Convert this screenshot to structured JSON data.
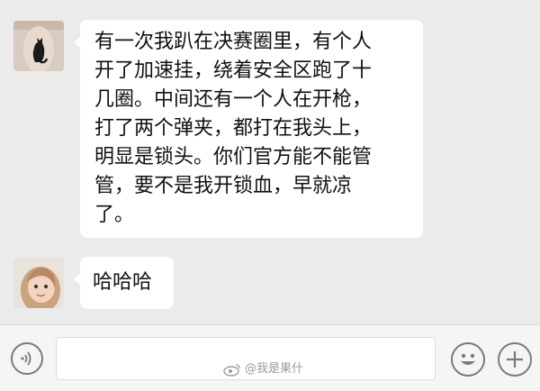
{
  "messages": [
    {
      "sender": "cat-avatar",
      "lines": [
        "有一次我趴在决赛圈里，有个人",
        "开了加速挂，绕着安全区跑了十",
        "几圈。中间还有一个人在开枪，",
        "打了两个弹夹，都打在我头上，",
        "明显是锁头。你们官方能不能管",
        "管，要不是我开锁血，早就凉",
        "了。"
      ]
    },
    {
      "sender": "girl-avatar",
      "text": "哈哈哈"
    }
  ],
  "input_bar": {
    "voice_icon": "voice-icon",
    "emoji_icon": "smiley-icon",
    "plus_icon": "plus-icon",
    "text_value": ""
  },
  "watermark": {
    "text": "@我是果什"
  },
  "colors": {
    "chat_bg": "#ebebeb",
    "bubble_bg": "#ffffff",
    "input_bar_bg": "#f5f5f6",
    "icon_gray": "#7a7a7a"
  }
}
